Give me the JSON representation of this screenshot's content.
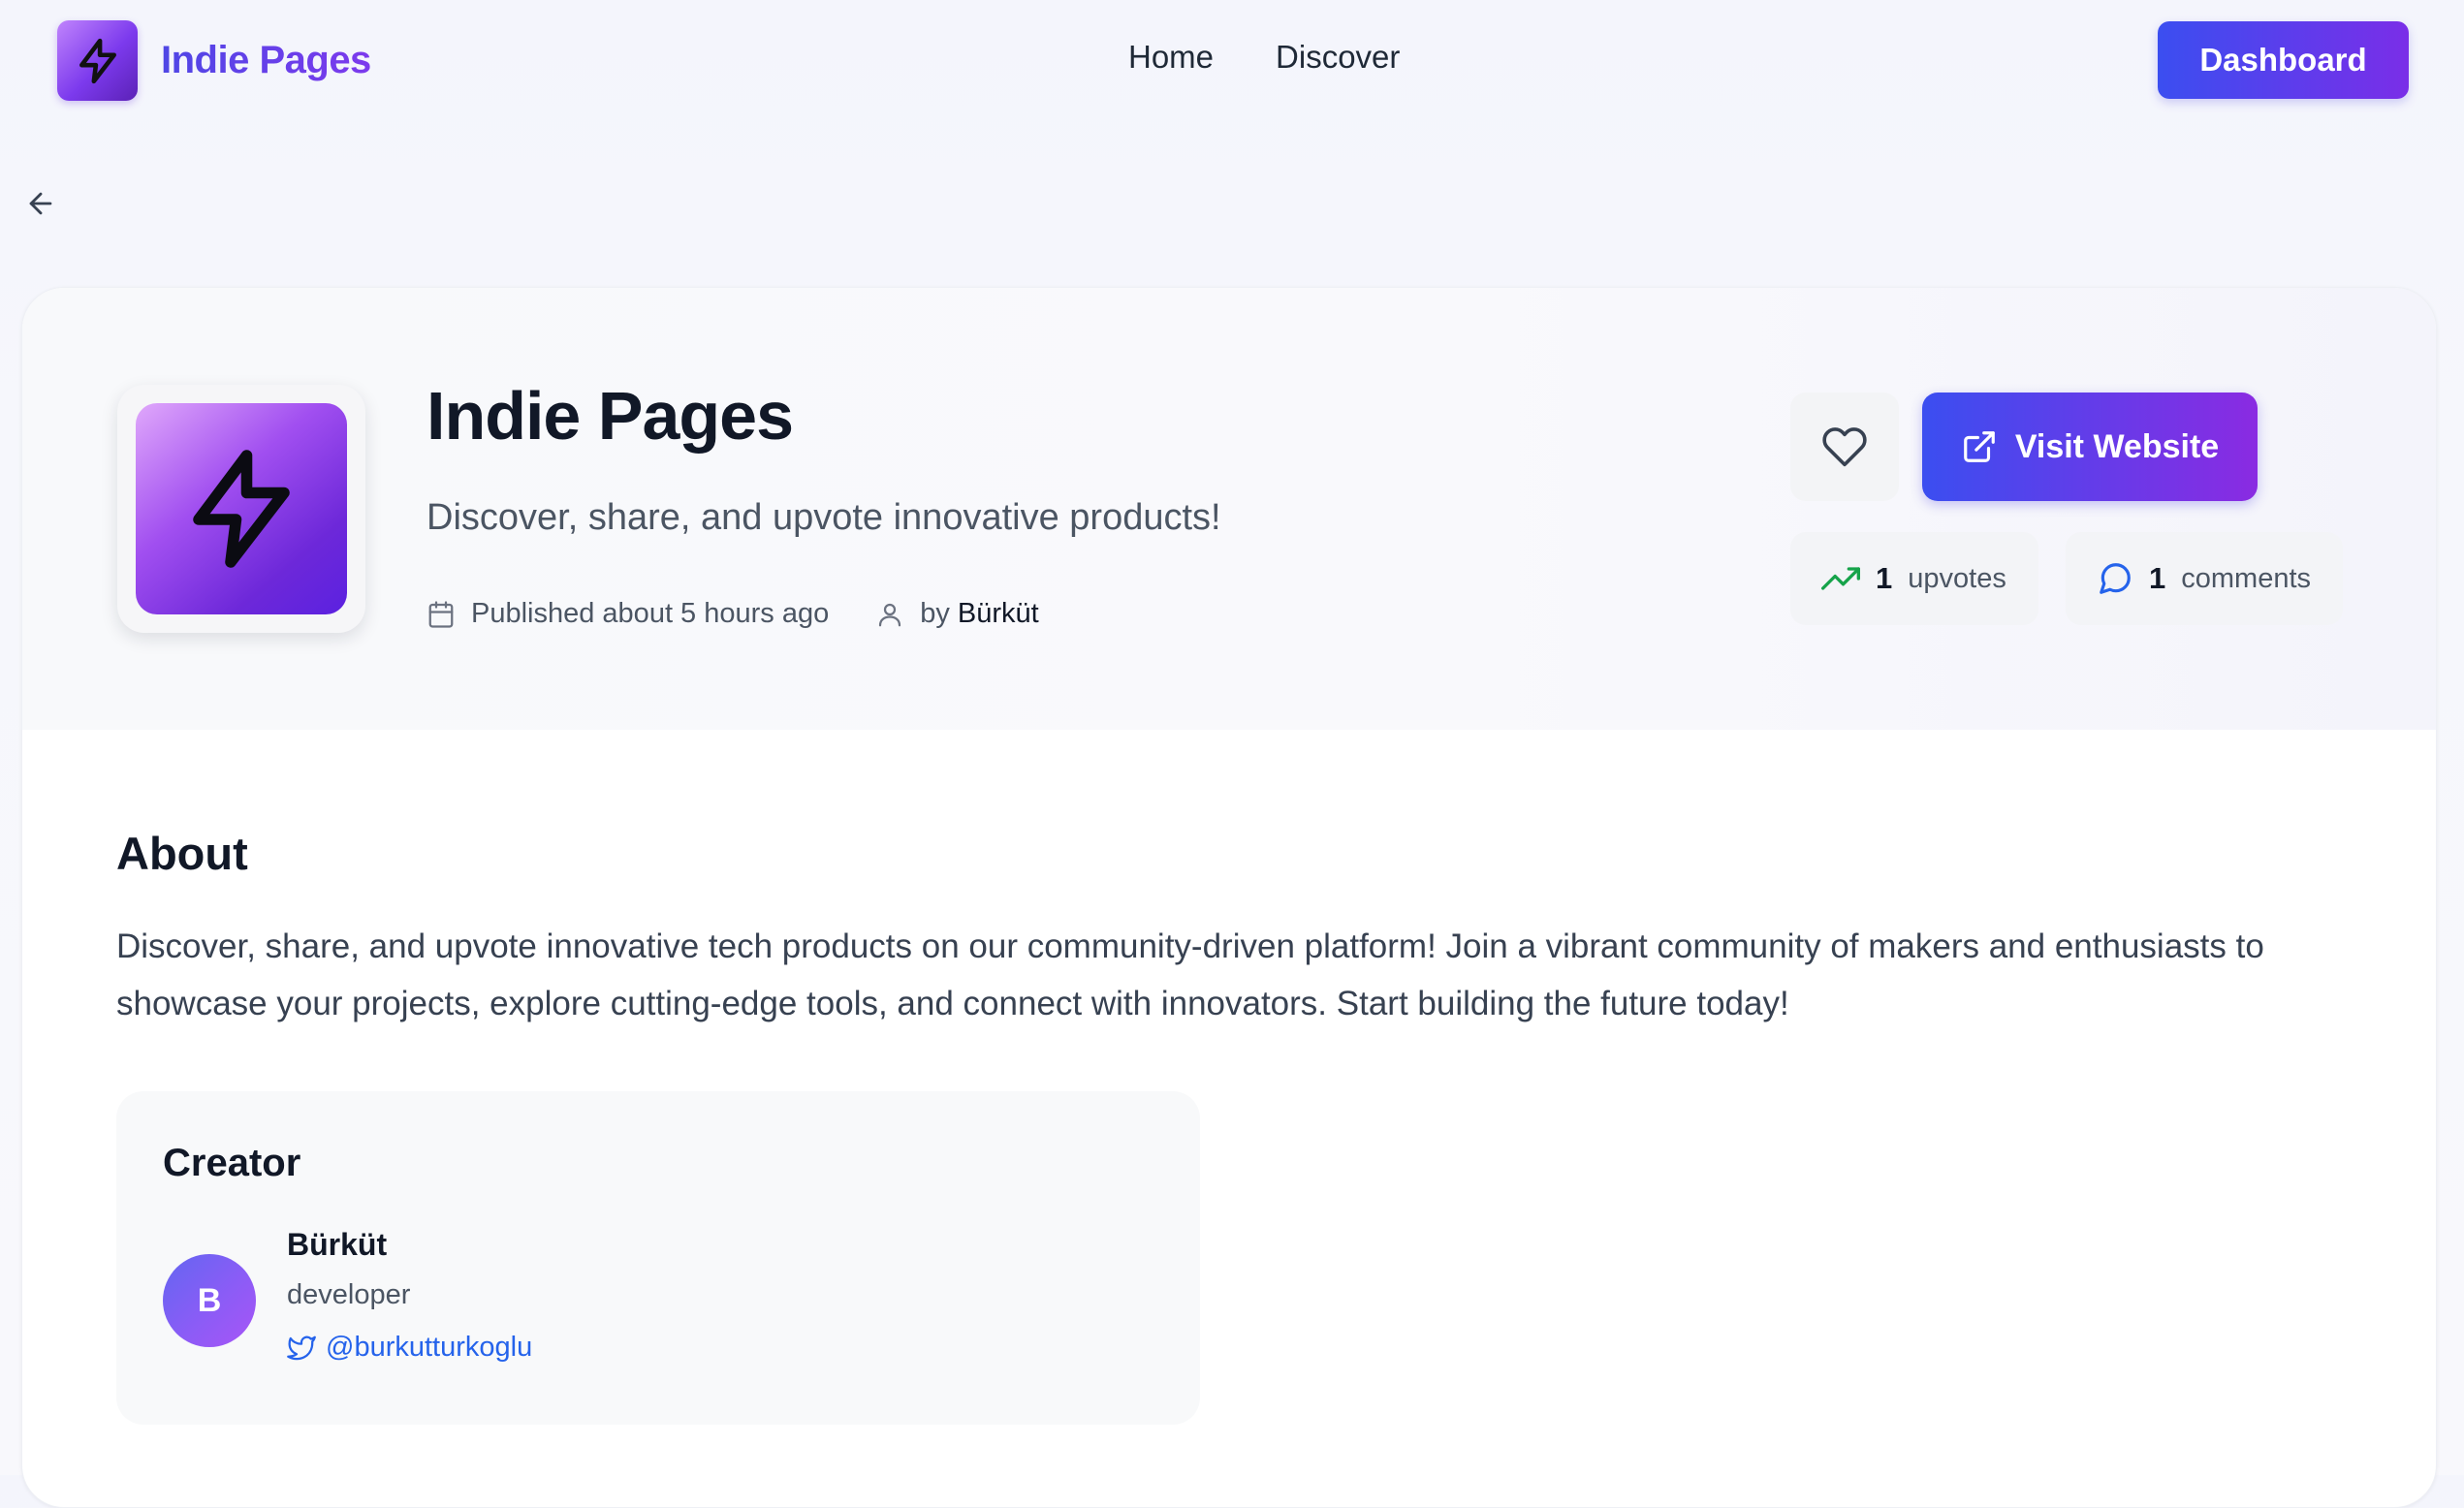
{
  "nav": {
    "brand": "Indie Pages",
    "links": [
      "Home",
      "Discover"
    ],
    "dashboard_label": "Dashboard"
  },
  "product": {
    "name": "Indie Pages",
    "tagline": "Discover, share, and upvote innovative products!",
    "published": "Published about 5 hours ago",
    "by_label": "by",
    "author": "Bürküt",
    "visit_label": "Visit Website",
    "upvotes_count": "1",
    "upvotes_label": "upvotes",
    "comments_count": "1",
    "comments_label": "comments"
  },
  "about": {
    "heading": "About",
    "text": "Discover, share, and upvote innovative tech products on our community-driven platform! Join a vibrant community of makers and enthusiasts to showcase your projects, explore cutting-edge tools, and connect with innovators. Start building the future today!"
  },
  "creator": {
    "heading": "Creator",
    "initial": "B",
    "name": "Bürküt",
    "role": "developer",
    "twitter": "@burkutturkoglu"
  },
  "icons": {
    "brand_logo": "lightning-bolt-icon",
    "back": "arrow-left-icon",
    "like": "heart-icon",
    "visit": "external-link-icon",
    "published": "calendar-icon",
    "author": "user-icon",
    "upvotes": "trending-up-icon",
    "comments": "message-circle-icon",
    "twitter": "twitter-icon"
  },
  "colors": {
    "accent_start": "#3b4ef0",
    "accent_end": "#8a2be2",
    "upvote_green": "#16a34a",
    "link_blue": "#2563eb"
  }
}
